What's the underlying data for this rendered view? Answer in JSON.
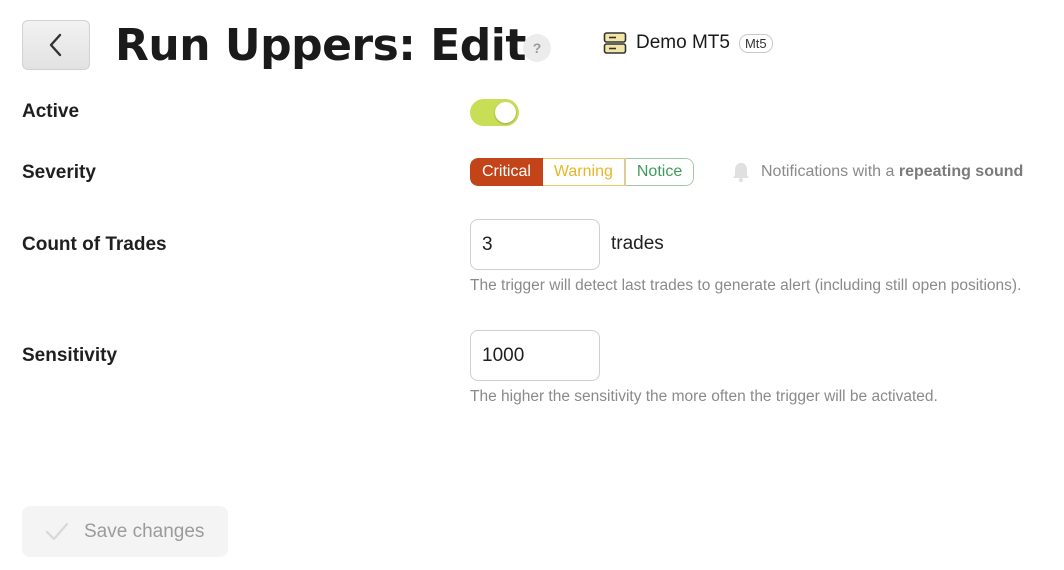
{
  "header": {
    "title": "Run Uppers: Edit",
    "help_label": "?",
    "account_name": "Demo MT5",
    "account_badge": "Mt5"
  },
  "active": {
    "label": "Active",
    "enabled": true
  },
  "severity": {
    "label": "Severity",
    "options": [
      "Critical",
      "Warning",
      "Notice"
    ],
    "selected": "Critical",
    "note_prefix": "Notifications with a",
    "note_emphasis": "repeating sound"
  },
  "count_of_trades": {
    "label": "Count of Trades",
    "value": "3",
    "unit": "trades",
    "hint": "The trigger will detect last trades to generate alert (including still open positions)."
  },
  "sensitivity": {
    "label": "Sensitivity",
    "value": "1000",
    "hint": "The higher the sensitivity the more often the trigger will be activated."
  },
  "footer": {
    "save_label": "Save changes"
  },
  "colors": {
    "toggle_on": "#c8df55",
    "critical": "#c4441a",
    "warning": "#e6b62a",
    "notice": "#3f9b5c"
  }
}
